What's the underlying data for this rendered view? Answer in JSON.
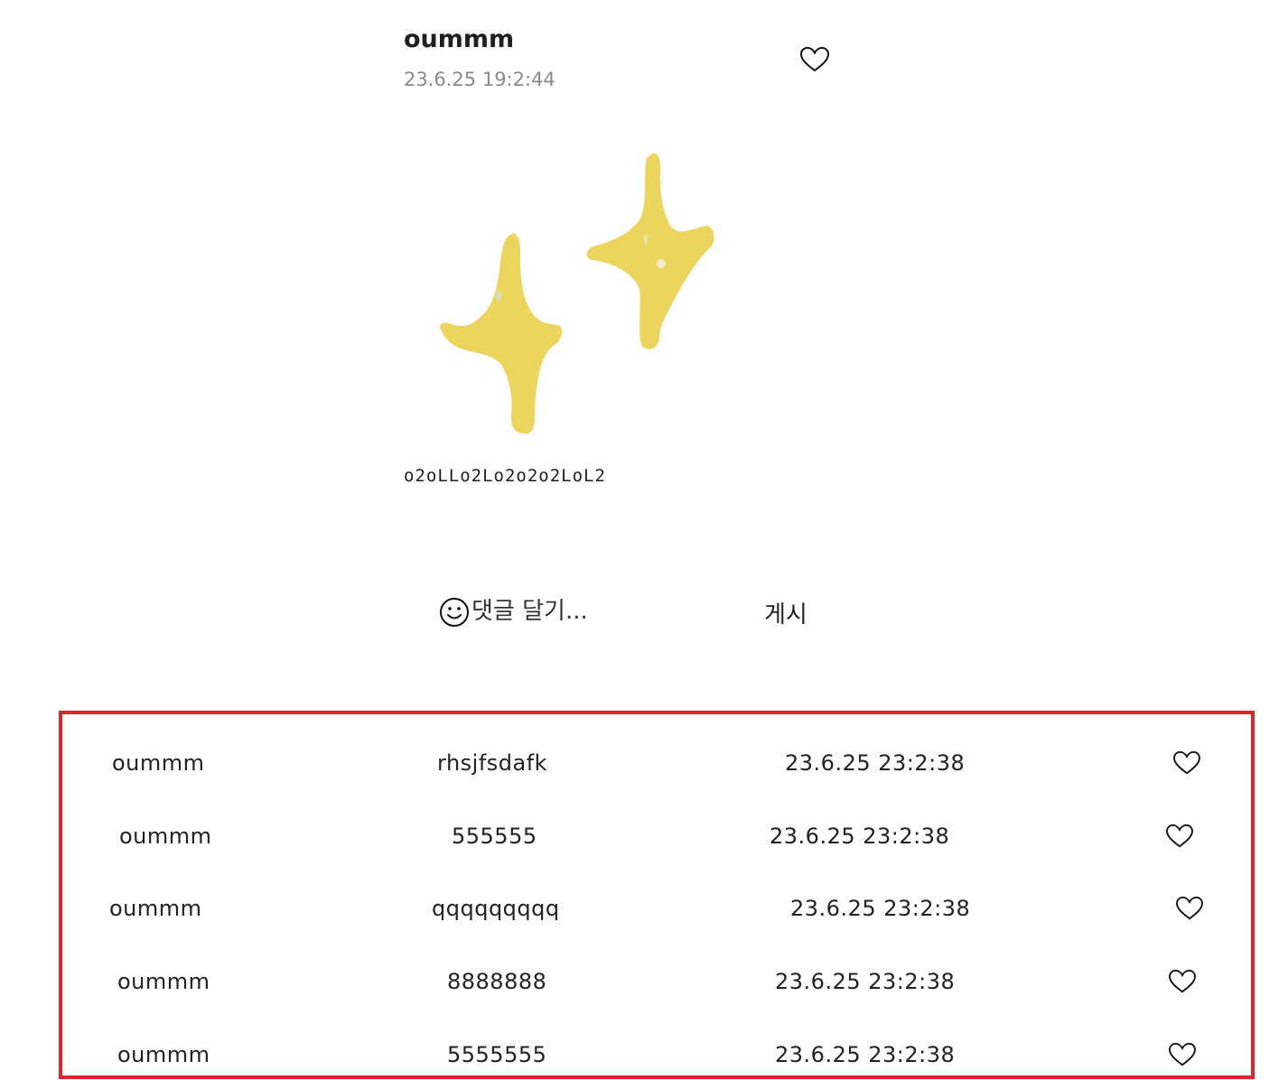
{
  "post": {
    "author": "oummm",
    "timestamp": "23.6.25 19:2:44",
    "caption": "o2oLLo2Lo2o2o2LoL2",
    "like_icon": "heart-outline-icon",
    "image_icon": "yellow-sparkles-drawing"
  },
  "comment_bar": {
    "emoji_icon": "smiley-icon",
    "placeholder": "댓글 달기...",
    "value": "",
    "post_label": "게시"
  },
  "comments": [
    {
      "author": "oummm",
      "text": "rhsjfsdafk",
      "timestamp": "23.6.25 23:2:38",
      "like_icon": "heart-outline-icon"
    },
    {
      "author": "oummm",
      "text": "555555",
      "timestamp": "23.6.25 23:2:38",
      "like_icon": "heart-outline-icon"
    },
    {
      "author": "oummm",
      "text": "qqqqqqqqq",
      "timestamp": "23.6.25 23:2:38",
      "like_icon": "heart-outline-icon"
    },
    {
      "author": "oummm",
      "text": "8888888",
      "timestamp": "23.6.25 23:2:38",
      "like_icon": "heart-outline-icon"
    },
    {
      "author": "oummm",
      "text": "5555555",
      "timestamp": "23.6.25 23:2:38",
      "like_icon": "heart-outline-icon"
    }
  ],
  "colors": {
    "highlight_border": "#e0242b",
    "sparkle_yellow": "#ecd55e",
    "muted_text": "#8a8a8a"
  }
}
